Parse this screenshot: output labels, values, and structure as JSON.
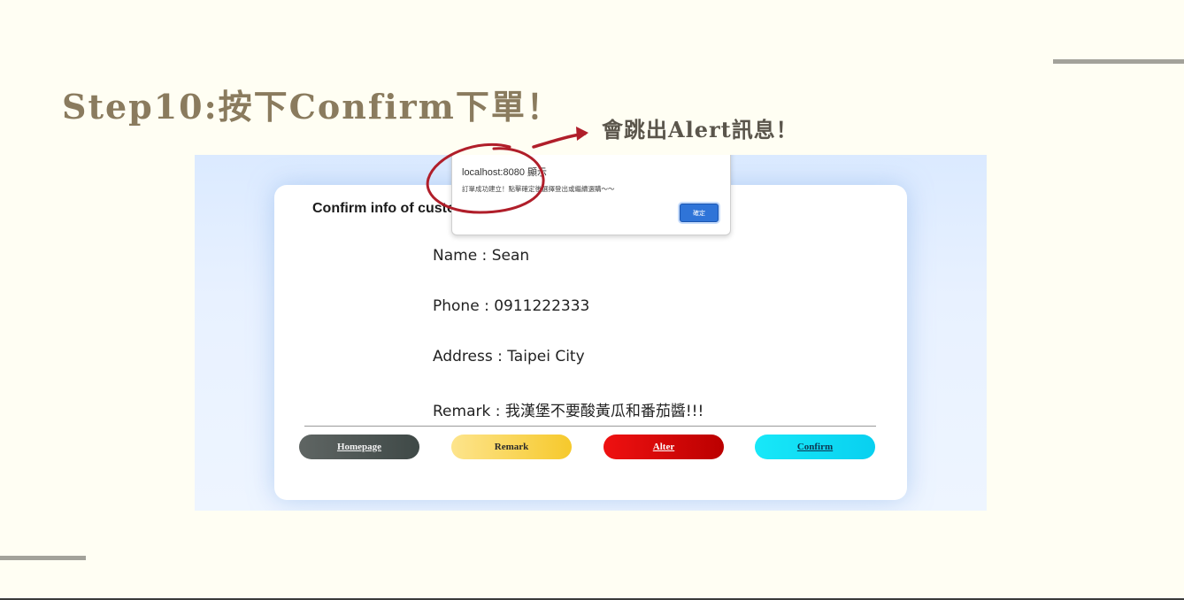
{
  "slide": {
    "title": "Step10:按下Confirm下單！",
    "note": "會跳出Alert訊息！"
  },
  "alert": {
    "title": "localhost:8080 顯示",
    "message": "訂單成功建立！點擊確定後選擇登出或繼續選購～～",
    "ok_label": "確定"
  },
  "card": {
    "title": "Confirm info of customer",
    "name_line": "Name : Sean",
    "phone_line": "Phone : 0911222333",
    "address_line": "Address : Taipei City",
    "remark_line": "Remark : 我漢堡不要酸黃瓜和番茄醬!!!"
  },
  "buttons": {
    "homepage": "Homepage",
    "remark": "Remark",
    "alter": "Alter",
    "confirm": "Confirm"
  },
  "colors": {
    "background": "#fffef3",
    "title": "#8a7b5e",
    "annotation": "#b01e2a",
    "alter": "#d40000",
    "confirm": "#10dcf4",
    "remark": "#f8d24a",
    "homepage": "#4e5755"
  },
  "icons": [
    "arrow-icon",
    "highlight-circle-icon"
  ]
}
